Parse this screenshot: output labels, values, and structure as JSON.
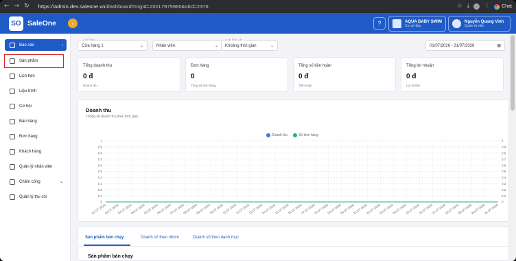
{
  "browser": {
    "url_host": "https://admin.dev.saleone.vn",
    "url_path": "/dashboard?orgId=20117975960&stId=2376",
    "chat_label": "Chat"
  },
  "header": {
    "logo_mark": "SO",
    "app_name": "SaleOne",
    "store_name": "AQUA BABY SWIM",
    "store_sub": "Cơ sở đầu",
    "user_name": "Nguyễn Quang Vinh",
    "user_role": "Quản trị viên"
  },
  "sidebar": {
    "items": [
      {
        "label": "Báo cáo",
        "icon": "report-icon"
      },
      {
        "label": "Sản phẩm",
        "icon": "product-icon"
      },
      {
        "label": "Lịch hẹn",
        "icon": "calendar-icon"
      },
      {
        "label": "Liệu trình",
        "icon": "treatment-icon"
      },
      {
        "label": "Cơ hội",
        "icon": "opportunity-icon"
      },
      {
        "label": "Bán hàng",
        "icon": "sales-icon"
      },
      {
        "label": "Đơn hàng",
        "icon": "order-icon"
      },
      {
        "label": "Khách hàng",
        "icon": "customer-icon"
      },
      {
        "label": "Quản lý nhân viên",
        "icon": "staff-icon"
      },
      {
        "label": "Chấm công",
        "icon": "timekeeping-icon"
      },
      {
        "label": "Quản lý thu chi",
        "icon": "finance-icon"
      }
    ]
  },
  "filters": {
    "store_label": "Cửa hàng",
    "store_value": "Cửa hàng 1",
    "staff_value": "Nhân viên",
    "report_type_label": "Loại báo cáo",
    "report_type_value": "Khoảng thời gian",
    "date_range": "01/07/2026 - 31/07/2026"
  },
  "cards": [
    {
      "title": "Tổng doanh thu",
      "value": "0 đ",
      "sub": "Doanh thu"
    },
    {
      "title": "Đơn hàng",
      "value": "0",
      "sub": "Tổng số đơn hàng"
    },
    {
      "title": "Tổng số tiền hoàn",
      "value": "0 đ",
      "sub": "Tiền hoàn"
    },
    {
      "title": "Tổng lợi nhuận",
      "value": "0 đ",
      "sub": "Lợi nhuận"
    }
  ],
  "revenue_chart": {
    "title": "Doanh thu",
    "subtitle": "Thống kê doanh thu theo thời gian"
  },
  "chart_data": {
    "type": "line",
    "series": [
      {
        "name": "Doanh thu",
        "color": "#2f7bf5",
        "values": [
          0,
          0,
          0,
          0,
          0,
          0,
          0,
          0,
          0,
          0,
          0,
          0,
          0,
          0,
          0,
          0,
          0,
          0,
          0,
          0,
          0,
          0,
          0,
          0,
          0,
          0,
          0,
          0,
          0,
          0,
          0
        ]
      },
      {
        "name": "Số đơn hàng",
        "color": "#21b26a",
        "values": [
          0,
          0,
          0,
          0,
          0,
          0,
          0,
          0,
          0,
          0,
          0,
          0,
          0,
          0,
          0,
          0,
          0,
          0,
          0,
          0,
          0,
          0,
          0,
          0,
          0,
          0,
          0,
          0,
          0,
          0,
          0
        ]
      }
    ],
    "x": [
      "01-07-2026",
      "02-07-2026",
      "03-07-2026",
      "04-07-2026",
      "05-07-2026",
      "06-07-2026",
      "07-07-2026",
      "08-07-2026",
      "09-07-2026",
      "10-07-2026",
      "11-07-2026",
      "12-07-2026",
      "13-07-2026",
      "14-07-2026",
      "15-07-2026",
      "16-07-2026",
      "17-07-2026",
      "18-07-2026",
      "19-07-2026",
      "20-07-2026",
      "21-07-2026",
      "22-07-2026",
      "23-07-2026",
      "24-07-2026",
      "25-07-2026",
      "26-07-2026",
      "27-07-2026",
      "28-07-2026",
      "29-07-2026",
      "30-07-2026",
      "31-07-2026"
    ],
    "y_left_ticks": [
      "1",
      "0.9",
      "0.8",
      "0.7",
      "0.6",
      "0.5",
      "0.4",
      "0.3",
      "0.2",
      "0.1",
      "0"
    ],
    "y_right_ticks": [
      "1",
      "0.9",
      "0.8",
      "0.7",
      "0.6",
      "0.5",
      "0.4",
      "0.3",
      "0.2",
      "0.1",
      "0"
    ],
    "ylim": [
      0,
      1
    ],
    "grid": true,
    "legend_position": "top-center"
  },
  "tabs": [
    {
      "label": "Sản phẩm bán chạy"
    },
    {
      "label": "Doanh số theo nhóm"
    },
    {
      "label": "Doanh số theo danh mục"
    }
  ],
  "tab_content_title": "Sản phẩm bán chạy"
}
